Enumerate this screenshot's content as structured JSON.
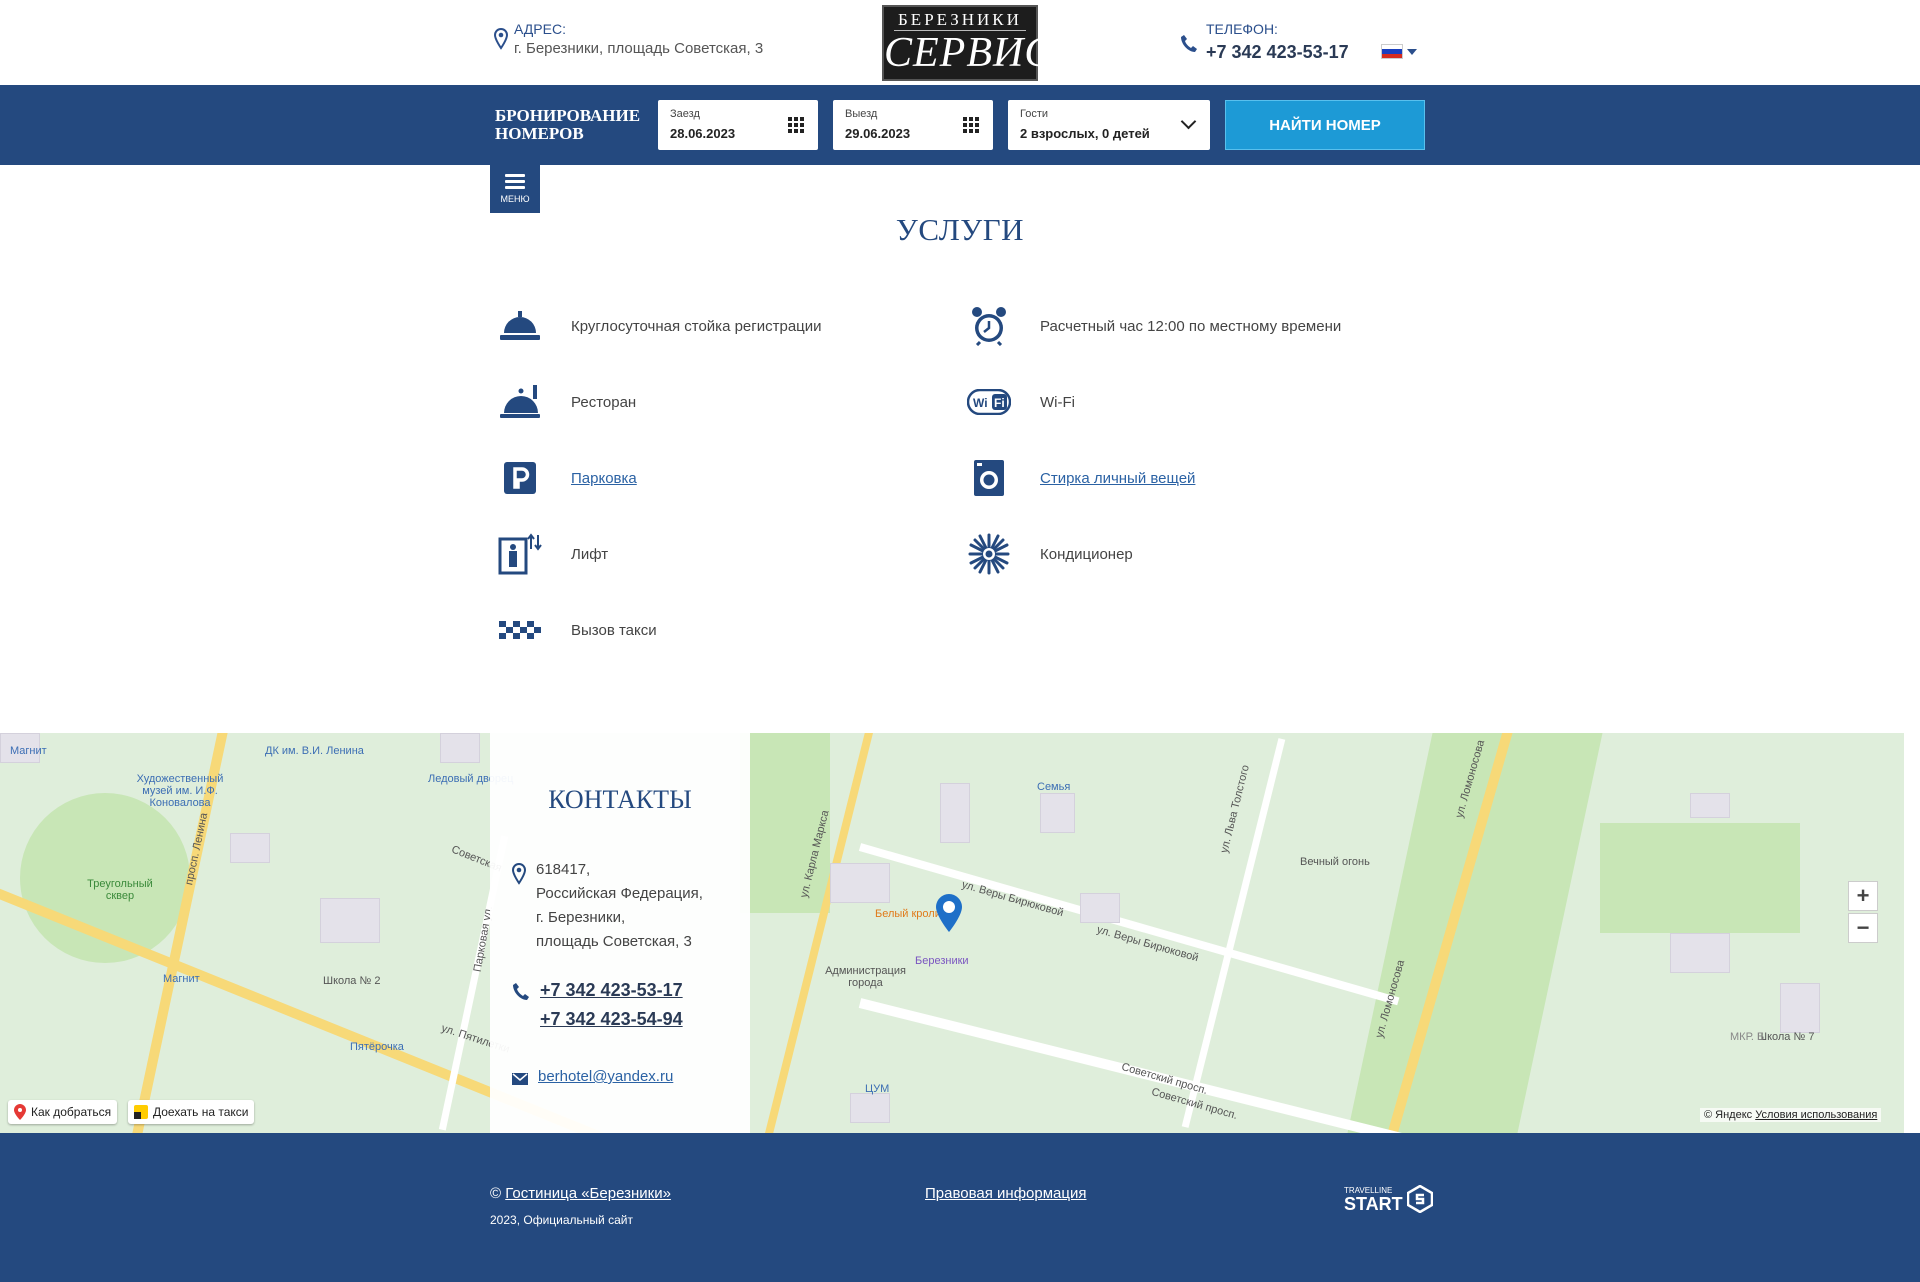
{
  "header": {
    "address_label": "АДРЕС:",
    "address": "г. Березники, площадь Советская, 3",
    "logo_top": "БЕРЕЗНИКИ",
    "logo_bottom": "СЕРВИС",
    "phone_label": "ТЕЛЕФОН:",
    "phone": "+7 342 423-53-17",
    "language_flag_colors": [
      "#ffffff",
      "#1a3fbf",
      "#d52b1e"
    ]
  },
  "booking": {
    "title_line1": "БРОНИРОВАНИЕ",
    "title_line2": "НОМЕРОВ",
    "checkin_label": "Заезд",
    "checkin_value": "28.06.2023",
    "checkout_label": "Выезд",
    "checkout_value": "29.06.2023",
    "guests_label": "Гости",
    "guests_value": "2 взрослых, 0 детей",
    "find_button": "НАЙТИ НОМЕР"
  },
  "menu": {
    "label": "МЕНЮ"
  },
  "services": {
    "title": "УСЛУГИ",
    "items": [
      {
        "icon": "reception-bell-icon",
        "label": "Круглосуточная стойка регистрации",
        "link": false
      },
      {
        "icon": "alarm-clock-icon",
        "label": "Расчетный час 12:00 по местному времени",
        "link": false
      },
      {
        "icon": "restaurant-cloche-icon",
        "label": "Ресторан",
        "link": false
      },
      {
        "icon": "wifi-icon",
        "label": "Wi-Fi",
        "link": false
      },
      {
        "icon": "parking-icon",
        "label": "Парковка",
        "link": true
      },
      {
        "icon": "washing-machine-icon",
        "label": "Стирка личный вещей",
        "link": true
      },
      {
        "icon": "elevator-icon",
        "label": "Лифт",
        "link": false
      },
      {
        "icon": "snowflake-icon",
        "label": "Кондиционер",
        "link": false
      },
      {
        "icon": "taxi-checker-icon",
        "label": "Вызов такси",
        "link": false
      }
    ]
  },
  "contacts": {
    "title": "КОНТАКТЫ",
    "address_lines": [
      "618417,",
      "Российская Федерация,",
      "г. Березники,",
      "площадь Советская, 3"
    ],
    "phones": [
      "+7 342 423-53-17",
      "+7 342 423-54-94"
    ],
    "email": "berhotel@yandex.ru"
  },
  "map": {
    "marker_label": "Березники",
    "pois": [
      "Белый кролик",
      "Администрация города",
      "Семья",
      "ЦУМ",
      "Вечный огонь",
      "Магнит",
      "Магнит",
      "Пятёрочка",
      "Художественный музей им. И.Ф. Коновалова",
      "ДК им. В.И. Ленина",
      "Ледовый дворец",
      "Треугольный сквер",
      "Школа № 2",
      "Школа № 7"
    ],
    "streets": [
      "ул. Веры Бирюковой",
      "ул. Веры Бирюковой",
      "ул. Карла Маркса",
      "ул. Льва Толстого",
      "ул. Ломоносова",
      "ул. Ломоносова",
      "Советский просп.",
      "Советский просп.",
      "просп. Ленина",
      "ул. Пятилетки",
      "Парковая ул.",
      "Советская",
      "МКР. Б"
    ],
    "route_button": "Как добраться",
    "taxi_button": "Доехать на такси",
    "copyright": "© Яндекс",
    "terms": "Условия использования",
    "zoom_in": "+",
    "zoom_out": "−"
  },
  "footer": {
    "copyright_prefix": "©",
    "hotel_link": "Гостиница «Березники»",
    "subline": "2023, Официальный сайт",
    "legal_link": "Правовая информация",
    "travelline_small": "TRAVELLINE",
    "travelline_big": "START"
  },
  "colors": {
    "brand_blue": "#24497f",
    "accent_cyan": "#1d9ad6",
    "link_blue": "#2b62a4"
  }
}
